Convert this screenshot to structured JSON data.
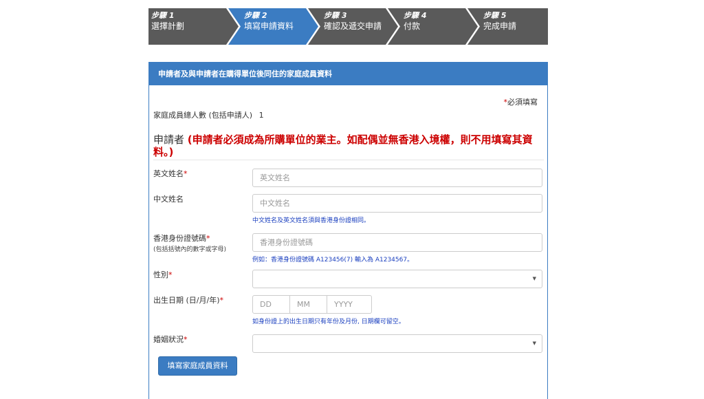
{
  "steps": [
    {
      "num": "步驟 1",
      "name": "選擇計劃"
    },
    {
      "num": "步驟 2",
      "name": "填寫申請資料"
    },
    {
      "num": "步驟 3",
      "name": "確認及遞交申請"
    },
    {
      "num": "步驟 4",
      "name": "付款"
    },
    {
      "num": "步驟 5",
      "name": "完成申請"
    }
  ],
  "colors": {
    "step_active": "#3b7cc2",
    "step_inactive": "#5a5a5a",
    "required": "#c00000",
    "hint": "#1a3fbf"
  },
  "panel": {
    "title": "申請者及與申請者在購得單位後同住的家庭成員資料",
    "required_star": "*",
    "required_text": "必須填寫",
    "member_count_label": "家庭成員總人數 (包括申請人)",
    "member_count_value": "1",
    "applicant_label": "申請者",
    "applicant_note": "(申請者必須成為所購單位的業主。如配偶並無香港入境權，則不用填寫其資料。)"
  },
  "form": {
    "english_name": {
      "label": "英文姓名",
      "star": "*",
      "placeholder": "英文姓名"
    },
    "chinese_name": {
      "label": "中文姓名",
      "placeholder": "中文姓名",
      "hint": "中文姓名及英文姓名須與香港身份證相同。"
    },
    "hkid": {
      "label": "香港身份證號碼",
      "star": "*",
      "sublabel": "(包括括號內的數字或字母)",
      "placeholder": "香港身份證號碼",
      "hint": "例如：香港身份證號碼 A123456(7) 輸入為 A1234567。"
    },
    "gender": {
      "label": "性別",
      "star": "*",
      "value": ""
    },
    "dob": {
      "label": "出生日期 (日/月/年)",
      "star": "*",
      "day": "DD",
      "month": "MM",
      "year": "YYYY",
      "hint": "如身份證上的出生日期只有年份及月份, 日期欄可留空。"
    },
    "marital": {
      "label": "婚姻狀況",
      "star": "*",
      "value": ""
    }
  },
  "buttons": {
    "fill_family": "填寫家庭成員資料"
  }
}
